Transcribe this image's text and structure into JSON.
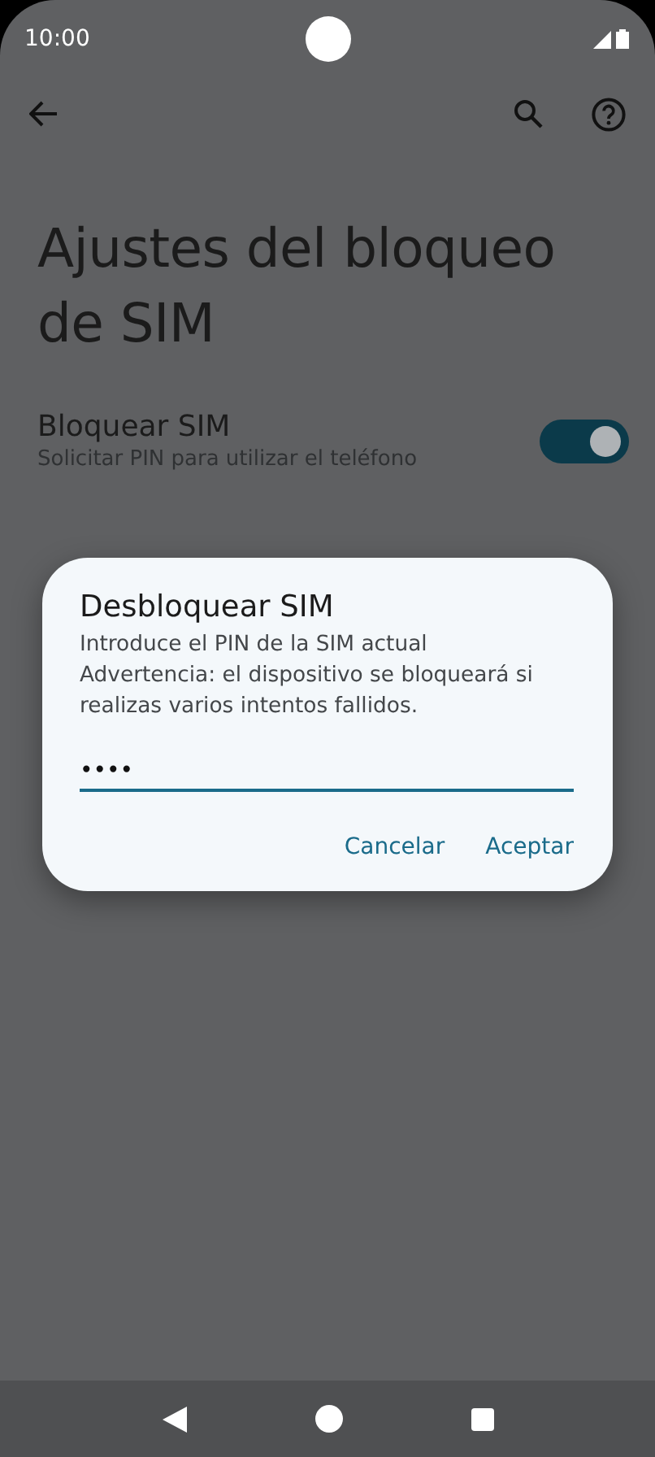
{
  "status_bar": {
    "time": "10:00"
  },
  "page": {
    "title": "Ajustes del bloqueo de SIM"
  },
  "settings": [
    {
      "kind": "switch",
      "title": "Bloquear SIM",
      "summary": "Solicitar PIN para utilizar el teléfono",
      "on": true
    }
  ],
  "dialog": {
    "title": "Desbloquear SIM",
    "message": "Introduce el PIN de la SIM actual\nAdvertencia: el dispositivo se bloqueará si realizas varios intentos fallidos.",
    "pin_field": {
      "value": "••••"
    },
    "buttons": [
      "Cancelar",
      "Aceptar"
    ]
  }
}
